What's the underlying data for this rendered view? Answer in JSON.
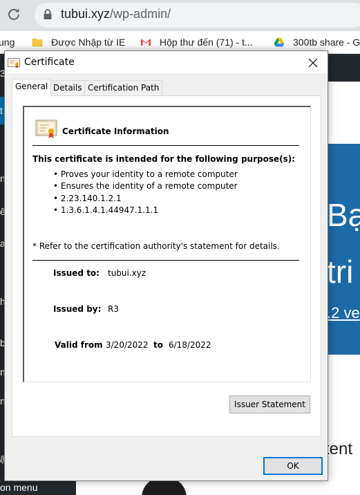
{
  "browser": {
    "url_host": "tubui.xyz",
    "url_path": "/wp-admin/",
    "bookmarks": [
      {
        "label": "ung",
        "icon": "truncated-bookmark"
      },
      {
        "label": "Được Nhập từ IE",
        "icon": "folder-icon"
      },
      {
        "label": "Hộp thư đến (71) - t...",
        "icon": "gmail-icon"
      },
      {
        "label": "300tb share - G",
        "icon": "google-drive-icon"
      }
    ]
  },
  "background_page": {
    "hero_lines": [
      "Bạ",
      "tri"
    ],
    "hero_link": ".2 ve",
    "tail_text": "tent",
    "sidebar_fragments": [
      "3",
      "t",
      "ng",
      "ê",
      "a",
      "h",
      "b",
      "n",
      "n",
      "ậ"
    ],
    "sidebar_menu": "on menu",
    "colors": {
      "sidebar": "#23282d",
      "hero": "#1d6aa8",
      "accent": "#0073aa"
    }
  },
  "dialog": {
    "title": "Certificate",
    "tabs": [
      {
        "label": "General",
        "active": true
      },
      {
        "label": "Details",
        "active": false
      },
      {
        "label": "Certification Path",
        "active": false
      }
    ],
    "info_title": "Certificate Information",
    "purpose_heading": "This certificate is intended for the following purpose(s):",
    "purposes": [
      "Proves your identity to a remote computer",
      "Ensures the identity of a remote computer",
      "2.23.140.1.2.1",
      "1.3.6.1.4.1.44947.1.1.1"
    ],
    "note": "* Refer to the certification authority's statement for details.",
    "issued_to_label": "Issued to:",
    "issued_to_value": "tubui.xyz",
    "issued_by_label": "Issued by:",
    "issued_by_value": "R3",
    "valid_from_label": "Valid from",
    "valid_from_value": "3/20/2022",
    "valid_to_label": "to",
    "valid_to_value": "6/18/2022",
    "issuer_statement_button": "Issuer Statement",
    "ok_button": "OK"
  }
}
